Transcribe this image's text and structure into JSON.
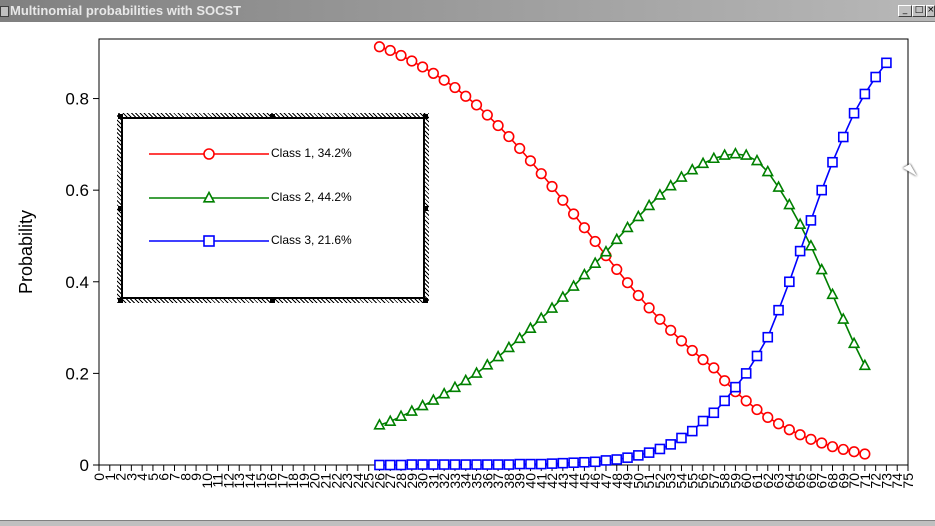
{
  "window": {
    "title": "Multinomial probabilities with SOCST",
    "minimize_label": "_",
    "maximize_label": "□",
    "close_label": "×"
  },
  "chart_data": {
    "type": "line",
    "title": "",
    "xlabel": "",
    "ylabel": "Probability",
    "xlim": [
      0,
      75
    ],
    "ylim": [
      0,
      0.93
    ],
    "x_ticks": [
      0,
      1,
      2,
      3,
      4,
      5,
      6,
      7,
      8,
      9,
      10,
      11,
      12,
      13,
      14,
      15,
      16,
      17,
      18,
      19,
      20,
      21,
      22,
      23,
      24,
      25,
      26,
      27,
      28,
      29,
      30,
      31,
      32,
      33,
      34,
      35,
      36,
      37,
      38,
      39,
      40,
      41,
      42,
      43,
      44,
      45,
      46,
      47,
      48,
      49,
      50,
      51,
      52,
      53,
      54,
      55,
      56,
      57,
      58,
      59,
      60,
      61,
      62,
      63,
      64,
      65,
      66,
      67,
      68,
      69,
      70,
      71,
      72,
      73,
      74,
      75
    ],
    "y_ticks": [
      0,
      0.2,
      0.4,
      0.6,
      0.8
    ],
    "y_tick_labels": [
      "0",
      "0.2",
      "0.4",
      "0.6",
      "0.8"
    ],
    "x_start": 26,
    "x_end": 71,
    "series": [
      {
        "name": "Class 1, 34.2%",
        "color": "#ff0000",
        "marker": "circle",
        "values": [
          0.913,
          0.905,
          0.894,
          0.882,
          0.869,
          0.855,
          0.84,
          0.824,
          0.805,
          0.786,
          0.764,
          0.741,
          0.717,
          0.691,
          0.664,
          0.636,
          0.608,
          0.578,
          0.548,
          0.518,
          0.488,
          0.457,
          0.427,
          0.398,
          0.37,
          0.343,
          0.318,
          0.294,
          0.271,
          0.25,
          0.23,
          0.212,
          0.184,
          0.16,
          0.14,
          0.121,
          0.104,
          0.09,
          0.077,
          0.066,
          0.056,
          0.048,
          0.04,
          0.034,
          0.029,
          0.024
        ]
      },
      {
        "name": "Class 2, 44.2%",
        "color": "#008000",
        "marker": "triangle",
        "values": [
          0.087,
          0.095,
          0.106,
          0.117,
          0.129,
          0.141,
          0.155,
          0.169,
          0.184,
          0.2,
          0.218,
          0.236,
          0.256,
          0.276,
          0.298,
          0.32,
          0.342,
          0.366,
          0.39,
          0.415,
          0.44,
          0.465,
          0.492,
          0.518,
          0.542,
          0.566,
          0.589,
          0.609,
          0.628,
          0.644,
          0.658,
          0.669,
          0.676,
          0.679,
          0.676,
          0.664,
          0.64,
          0.606,
          0.568,
          0.525,
          0.478,
          0.426,
          0.372,
          0.318,
          0.265,
          0.217
        ]
      },
      {
        "name": "Class 3, 21.6%",
        "color": "#0000ff",
        "marker": "square",
        "values": [
          0.0,
          0.0,
          0.0,
          0.001,
          0.001,
          0.001,
          0.001,
          0.001,
          0.001,
          0.001,
          0.001,
          0.001,
          0.001,
          0.002,
          0.002,
          0.002,
          0.003,
          0.004,
          0.005,
          0.006,
          0.007,
          0.01,
          0.012,
          0.016,
          0.021,
          0.027,
          0.035,
          0.045,
          0.059,
          0.074,
          0.096,
          0.114,
          0.14,
          0.17,
          0.2,
          0.238,
          0.279,
          0.338,
          0.4,
          0.467,
          0.534,
          0.6,
          0.661,
          0.716,
          0.768,
          0.81,
          0.847,
          0.878
        ]
      }
    ],
    "legend_position": "left, inside plot",
    "grid": false
  }
}
